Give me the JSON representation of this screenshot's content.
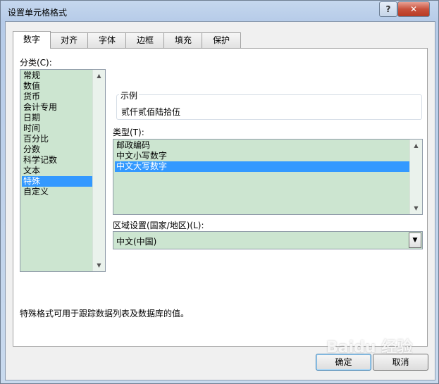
{
  "window": {
    "title": "设置单元格格式",
    "help_label": "?",
    "close_label": "✕"
  },
  "tabs": [
    {
      "label": "数字",
      "active": true
    },
    {
      "label": "对齐",
      "active": false
    },
    {
      "label": "字体",
      "active": false
    },
    {
      "label": "边框",
      "active": false
    },
    {
      "label": "填充",
      "active": false
    },
    {
      "label": "保护",
      "active": false
    }
  ],
  "category": {
    "label": "分类(C):",
    "items": [
      "常规",
      "数值",
      "货币",
      "会计专用",
      "日期",
      "时间",
      "百分比",
      "分数",
      "科学记数",
      "文本",
      "特殊",
      "自定义"
    ],
    "selected": "特殊"
  },
  "sample": {
    "label": "示例",
    "value": "贰仟贰佰陆拾伍"
  },
  "type": {
    "label": "类型(T):",
    "items": [
      "邮政编码",
      "中文小写数字",
      "中文大写数字"
    ],
    "selected": "中文大写数字"
  },
  "locale": {
    "label": "区域设置(国家/地区)(L):",
    "value": "中文(中国)"
  },
  "description": "特殊格式可用于跟踪数据列表及数据库的值。",
  "buttons": {
    "ok_label": "确定",
    "cancel_label": "取消"
  },
  "watermark": "Baidu 经验",
  "colors": {
    "list_bg": "#cce5d0",
    "selection": "#3399ff",
    "close_button": "#c8513c"
  }
}
